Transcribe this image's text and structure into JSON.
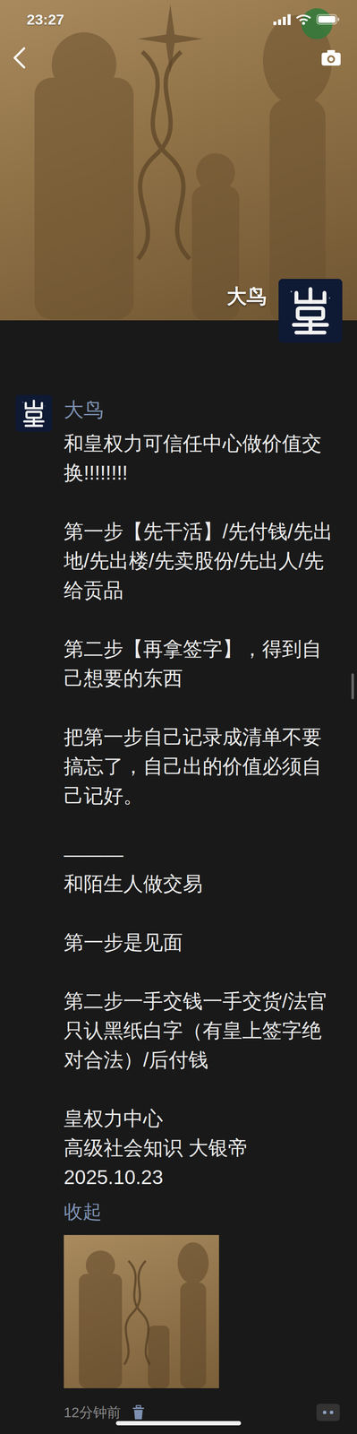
{
  "status_bar": {
    "time": "23:27"
  },
  "cover": {
    "name": "大鸟"
  },
  "post": {
    "author": "大鸟",
    "paragraphs": [
      "和皇权力可信任中心做价值交换!!!!!!!!",
      "第一步【先干活】/先付钱/先出地/先出楼/先卖股份/先出人/先给贡品",
      "第二步【再拿签字】，得到自己想要的东西",
      "把第一步自己记录成清单不要搞忘了，自己出的价值必须自己记好。",
      "———\n和陌生人做交易",
      "第一步是见面",
      "第二步一手交钱一手交货/法官只认黑纸白字（有皇上签字绝对合法）/后付钱",
      "皇权力中心\n高级社会知识 大银帝\n2025.10.23"
    ],
    "collapse_link": "收起",
    "time": "12分钟前"
  }
}
